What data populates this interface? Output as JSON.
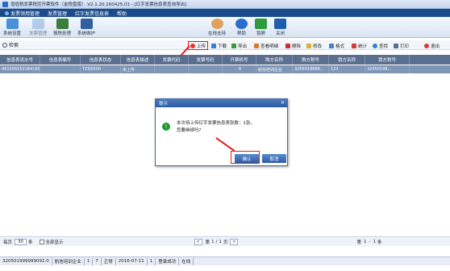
{
  "window": {
    "title": "增值税发票税控开票软件（金税盘版） V2.1.20.160425.01 - [红字发票信息表查询导出]"
  },
  "menu": [
    "发票领用管理",
    "发票管理",
    "红字发票信息表",
    "帮助"
  ],
  "toolbar": {
    "left": [
      "系统设置",
      "发票管理",
      "报税处理",
      "系统维护"
    ],
    "right": [
      "在线支持",
      "帮助",
      "锁屏",
      "关闭"
    ]
  },
  "search": {
    "label": "检索",
    "value": ""
  },
  "actions": [
    "上传",
    "下载",
    "导出",
    "查看明细",
    "删除",
    "修改",
    "格式",
    "统计",
    "查找",
    "打印",
    "退出"
  ],
  "table": {
    "columns": [
      "信息表流水号",
      "信息表编号",
      "信息表状态",
      "信息表描述",
      "发票代码",
      "发票号码",
      "开票机号",
      "购方名称",
      "购方税号",
      "销方名称",
      "销方税号"
    ],
    "rows": [
      [
        "0615001521641607111711520",
        "",
        "TZD0500",
        "未上传",
        "",
        "",
        "0",
        "航信培训企业",
        "3205018888...",
        "123",
        "32050199..."
      ]
    ]
  },
  "dialog": {
    "title": "提示",
    "message_line1": "本次待上传红字发票信息表张数：1张。",
    "message_line2": "您要继续吗?",
    "ok": "确认",
    "cancel": "取消"
  },
  "pager": {
    "per_page_label": "每页",
    "per_page_value": "30",
    "unit": "条",
    "show_all": "全部显示",
    "page_prefix": "第",
    "page": "1",
    "page_mid": "/",
    "total_pages": "1",
    "page_suffix": "页",
    "range_prefix": "第",
    "range_start": "1",
    "range_dash": "-",
    "range_end": "1",
    "range_suffix": "条"
  },
  "status": [
    "320501999999092.0",
    "航信培训企业",
    "1",
    "7",
    "正常",
    "2016-07-11",
    "1",
    "登录成功",
    "在线"
  ]
}
